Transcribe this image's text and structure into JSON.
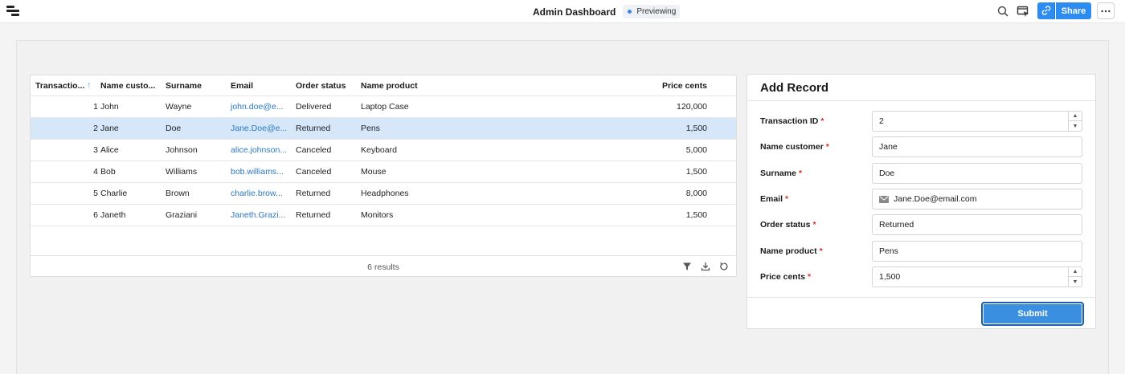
{
  "app": {
    "title": "Admin Dashboard",
    "status_badge": "Previewing",
    "share_label": "Share"
  },
  "table": {
    "columns": [
      "Transactio...",
      "Name custo...",
      "Surname",
      "Email",
      "Order status",
      "Name product",
      "Price cents"
    ],
    "sort_indicator": "↑",
    "rows": [
      {
        "id": "1",
        "name": "John",
        "surname": "Wayne",
        "email": "john.doe@e...",
        "status": "Delivered",
        "product": "Laptop Case",
        "price": "120,000"
      },
      {
        "id": "2",
        "name": "Jane",
        "surname": "Doe",
        "email": "Jane.Doe@e...",
        "status": "Returned",
        "product": "Pens",
        "price": "1,500"
      },
      {
        "id": "3",
        "name": "Alice",
        "surname": "Johnson",
        "email": "alice.johnson...",
        "status": "Canceled",
        "product": "Keyboard",
        "price": "5,000"
      },
      {
        "id": "4",
        "name": "Bob",
        "surname": "Williams",
        "email": "bob.williams...",
        "status": "Canceled",
        "product": "Mouse",
        "price": "1,500"
      },
      {
        "id": "5",
        "name": "Charlie",
        "surname": "Brown",
        "email": "charlie.brow...",
        "status": "Returned",
        "product": "Headphones",
        "price": "8,000"
      },
      {
        "id": "6",
        "name": "Janeth",
        "surname": "Graziani",
        "email": "Janeth.Grazi...",
        "status": "Returned",
        "product": "Monitors",
        "price": "1,500"
      }
    ],
    "selected_row": 2,
    "results_label": "6 results"
  },
  "form": {
    "title": "Add Record",
    "required_marker": "*",
    "fields": [
      {
        "label": "Transaction ID",
        "value": "2"
      },
      {
        "label": "Name customer",
        "value": "Jane"
      },
      {
        "label": "Surname",
        "value": "Doe"
      },
      {
        "label": "Email",
        "value": "Jane.Doe@email.com"
      },
      {
        "label": "Order status",
        "value": "Returned"
      },
      {
        "label": "Name product",
        "value": "Pens"
      },
      {
        "label": "Price cents",
        "value": "1,500"
      }
    ],
    "submit_label": "Submit"
  },
  "icons": {
    "logo": "retool-logo-icon",
    "search": "search-icon",
    "preview": "preview-icon",
    "link": "link-icon",
    "more": "more-icon",
    "filter": "filter-icon",
    "download": "download-icon",
    "refresh": "refresh-icon",
    "mail": "mail-icon"
  },
  "colors": {
    "accent": "#2d8cf0",
    "selected_row": "#d5e7f8",
    "link_text": "#2b79c2",
    "required": "#d93025"
  }
}
